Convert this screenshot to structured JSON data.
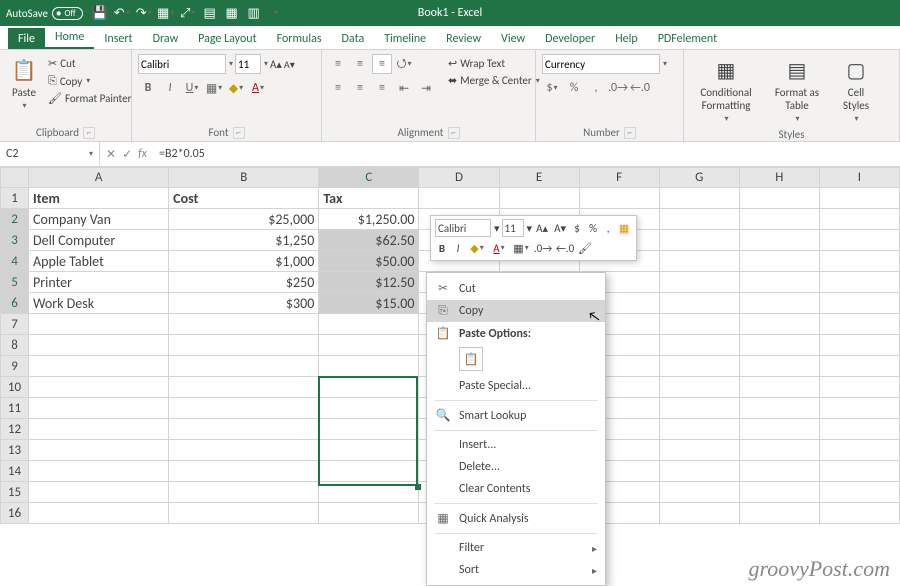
{
  "titlebar": {
    "autosave_label": "AutoSave",
    "autosave_state": "Off",
    "title": "Book1 - Excel"
  },
  "tabs": [
    "File",
    "Home",
    "Insert",
    "Draw",
    "Page Layout",
    "Formulas",
    "Data",
    "Timeline",
    "Review",
    "View",
    "Developer",
    "Help",
    "PDFelement"
  ],
  "active_tab": "Home",
  "ribbon": {
    "clipboard": {
      "paste": "Paste",
      "cut": "Cut",
      "copy": "Copy",
      "painter": "Format Painter",
      "label": "Clipboard"
    },
    "font": {
      "name": "Calibri",
      "size": "11",
      "label": "Font"
    },
    "alignment": {
      "wrap": "Wrap Text",
      "merge": "Merge & Center",
      "label": "Alignment"
    },
    "number": {
      "format": "Currency",
      "label": "Number"
    },
    "styles": {
      "cond": "Conditional Formatting",
      "table": "Format as Table",
      "cell": "Cell Styles",
      "label": "Styles"
    }
  },
  "formula_bar": {
    "name": "C2",
    "formula": "=B2*0.05"
  },
  "columns": [
    "A",
    "B",
    "C",
    "D",
    "E",
    "F",
    "G",
    "H",
    "I"
  ],
  "headers": {
    "A": "Item",
    "B": "Cost",
    "C": "Tax"
  },
  "rows": [
    {
      "n": 1
    },
    {
      "n": 2,
      "A": "Company Van",
      "B": "$25,000",
      "C": "$1,250.00"
    },
    {
      "n": 3,
      "A": "Dell Computer",
      "B": "$1,250",
      "C": "$62.50"
    },
    {
      "n": 4,
      "A": "Apple Tablet",
      "B": "$1,000",
      "C": "$50.00"
    },
    {
      "n": 5,
      "A": "Printer",
      "B": "$250",
      "C": "$12.50"
    },
    {
      "n": 6,
      "A": "Work Desk",
      "B": "$300",
      "C": "$15.00"
    },
    {
      "n": 7
    },
    {
      "n": 8
    },
    {
      "n": 9
    },
    {
      "n": 10
    },
    {
      "n": 11
    },
    {
      "n": 12
    },
    {
      "n": 13
    },
    {
      "n": 14
    },
    {
      "n": 15
    },
    {
      "n": 16
    }
  ],
  "mini": {
    "font": "Calibri",
    "size": "11"
  },
  "ctx": {
    "cut": "Cut",
    "copy": "Copy",
    "paste_hdr": "Paste Options:",
    "paste_special": "Paste Special...",
    "smart": "Smart Lookup",
    "insert": "Insert...",
    "delete": "Delete...",
    "clear": "Clear Contents",
    "quick": "Quick Analysis",
    "filter": "Filter",
    "sort": "Sort"
  },
  "watermark": "groovyPost.com"
}
